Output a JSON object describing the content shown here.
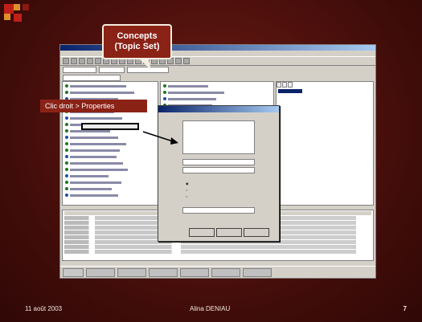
{
  "slide": {
    "callout_line1": "Concepts",
    "callout_line2": "(Topic Set)",
    "action_label": "Clic droit >  Properties",
    "footer_date": "11 août 2003",
    "footer_author": "Alina DENIAU",
    "page_number": "7"
  },
  "colors": {
    "background": "#4a0e0a",
    "callout_fill": "#8b2216",
    "corner_red": "#c0201a",
    "corner_orange": "#e0902a"
  }
}
